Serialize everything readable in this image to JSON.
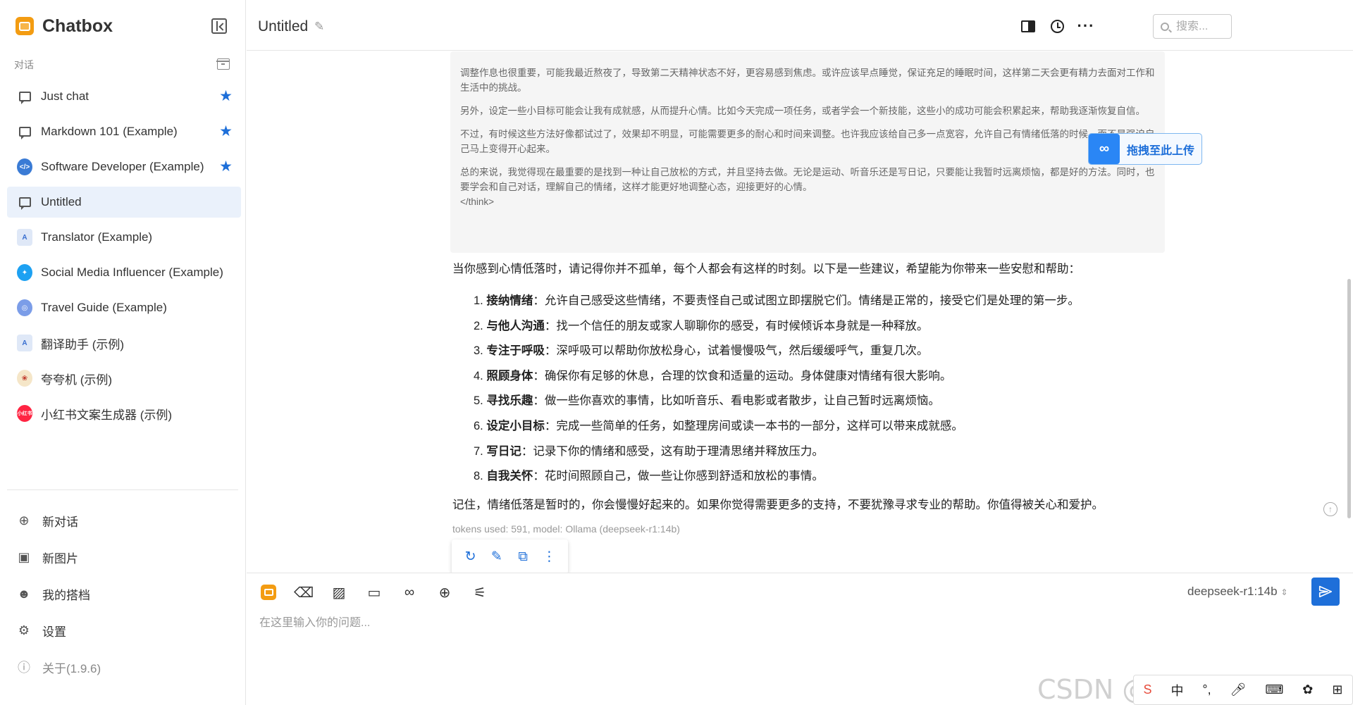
{
  "app": {
    "title": "Chatbox"
  },
  "sidebar": {
    "section_label": "对话",
    "chats": [
      {
        "label": "Just chat",
        "icon": "chat-bubble-icon",
        "starred": true
      },
      {
        "label": "Markdown 101 (Example)",
        "icon": "chat-bubble-icon",
        "starred": true
      },
      {
        "label": "Software Developer (Example)",
        "icon": "developer-avatar",
        "starred": true
      },
      {
        "label": "Untitled",
        "icon": "chat-bubble-icon",
        "starred": false,
        "active": true
      },
      {
        "label": "Translator (Example)",
        "icon": "translator-avatar",
        "starred": false
      },
      {
        "label": "Social Media Influencer (Example)",
        "icon": "twitter-avatar",
        "starred": false
      },
      {
        "label": "Travel Guide (Example)",
        "icon": "globe-avatar",
        "starred": false
      },
      {
        "label": "翻译助手 (示例)",
        "icon": "translator-avatar",
        "starred": false
      },
      {
        "label": "夸夸机 (示例)",
        "icon": "praise-avatar",
        "starred": false
      },
      {
        "label": "小红书文案生成器 (示例)",
        "icon": "xiaohongshu-avatar",
        "avatar_text": "小红书",
        "starred": false
      }
    ],
    "menu": {
      "new_chat": "新对话",
      "new_image": "新图片",
      "my_partners": "我的搭档",
      "settings": "设置",
      "about": "关于(1.9.6)"
    }
  },
  "header": {
    "title": "Untitled",
    "search_placeholder": "搜索..."
  },
  "think": {
    "paragraphs": [
      "调整作息也很重要，可能我最近熬夜了，导致第二天精神状态不好，更容易感到焦虑。或许应该早点睡觉，保证充足的睡眠时间，这样第二天会更有精力去面对工作和生活中的挑战。",
      "另外，设定一些小目标可能会让我有成就感，从而提升心情。比如今天完成一项任务，或者学会一个新技能，这些小的成功可能会积累起来，帮助我逐渐恢复自信。",
      "不过，有时候这些方法好像都试过了，效果却不明显，可能需要更多的耐心和时间来调整。也许我应该给自己多一点宽容，允许自己有情绪低落的时候，而不是强迫自己马上变得开心起来。",
      "总的来说，我觉得现在最重要的是找到一种让自己放松的方式，并且坚持去做。无论是运动、听音乐还是写日记，只要能让我暂时远离烦恼，都是好的方法。同时，也要学会和自己对话，理解自己的情绪，这样才能更好地调整心态，迎接更好的心情。"
    ],
    "end_tag": "</think>"
  },
  "baidu_badge": {
    "label": "拖拽至此上传"
  },
  "answer": {
    "intro": "当你感到心情低落时，请记得你并不孤单，每个人都会有这样的时刻。以下是一些建议，希望能为你带来一些安慰和帮助：",
    "items": [
      {
        "n": "1.",
        "title": "接纳情绪",
        "text": "：允许自己感受这些情绪，不要责怪自己或试图立即摆脱它们。情绪是正常的，接受它们是处理的第一步。"
      },
      {
        "n": "2.",
        "title": "与他人沟通",
        "text": "：找一个信任的朋友或家人聊聊你的感受，有时候倾诉本身就是一种释放。"
      },
      {
        "n": "3.",
        "title": "专注于呼吸",
        "text": "：深呼吸可以帮助你放松身心，试着慢慢吸气，然后缓缓呼气，重复几次。"
      },
      {
        "n": "4.",
        "title": "照顾身体",
        "text": "：确保你有足够的休息，合理的饮食和适量的运动。身体健康对情绪有很大影响。"
      },
      {
        "n": "5.",
        "title": "寻找乐趣",
        "text": "：做一些你喜欢的事情，比如听音乐、看电影或者散步，让自己暂时远离烦恼。"
      },
      {
        "n": "6.",
        "title": "设定小目标",
        "text": "：完成一些简单的任务，如整理房间或读一本书的一部分，这样可以带来成就感。"
      },
      {
        "n": "7.",
        "title": "写日记",
        "text": "：记录下你的情绪和感受，这有助于理清思绪并释放压力。"
      },
      {
        "n": "8.",
        "title": "自我关怀",
        "text": "：花时间照顾自己，做一些让你感到舒适和放松的事情。"
      }
    ],
    "outro": "记住，情绪低落是暂时的，你会慢慢好起来的。如果你觉得需要更多的支持，不要犹豫寻求专业的帮助。你值得被关心和爱护。",
    "tokens": "tokens used: 591, model: Ollama (deepseek-r1:14b)"
  },
  "input": {
    "placeholder": "在这里输入你的问题...",
    "model": "deepseek-r1:14b"
  },
  "watermark": "CSDN @还不秃顶的计科生",
  "ime": {
    "mode": "中"
  },
  "colors": {
    "accent": "#1e6fd9",
    "brand": "#f39c12",
    "active_bg": "#eaf1fb"
  }
}
